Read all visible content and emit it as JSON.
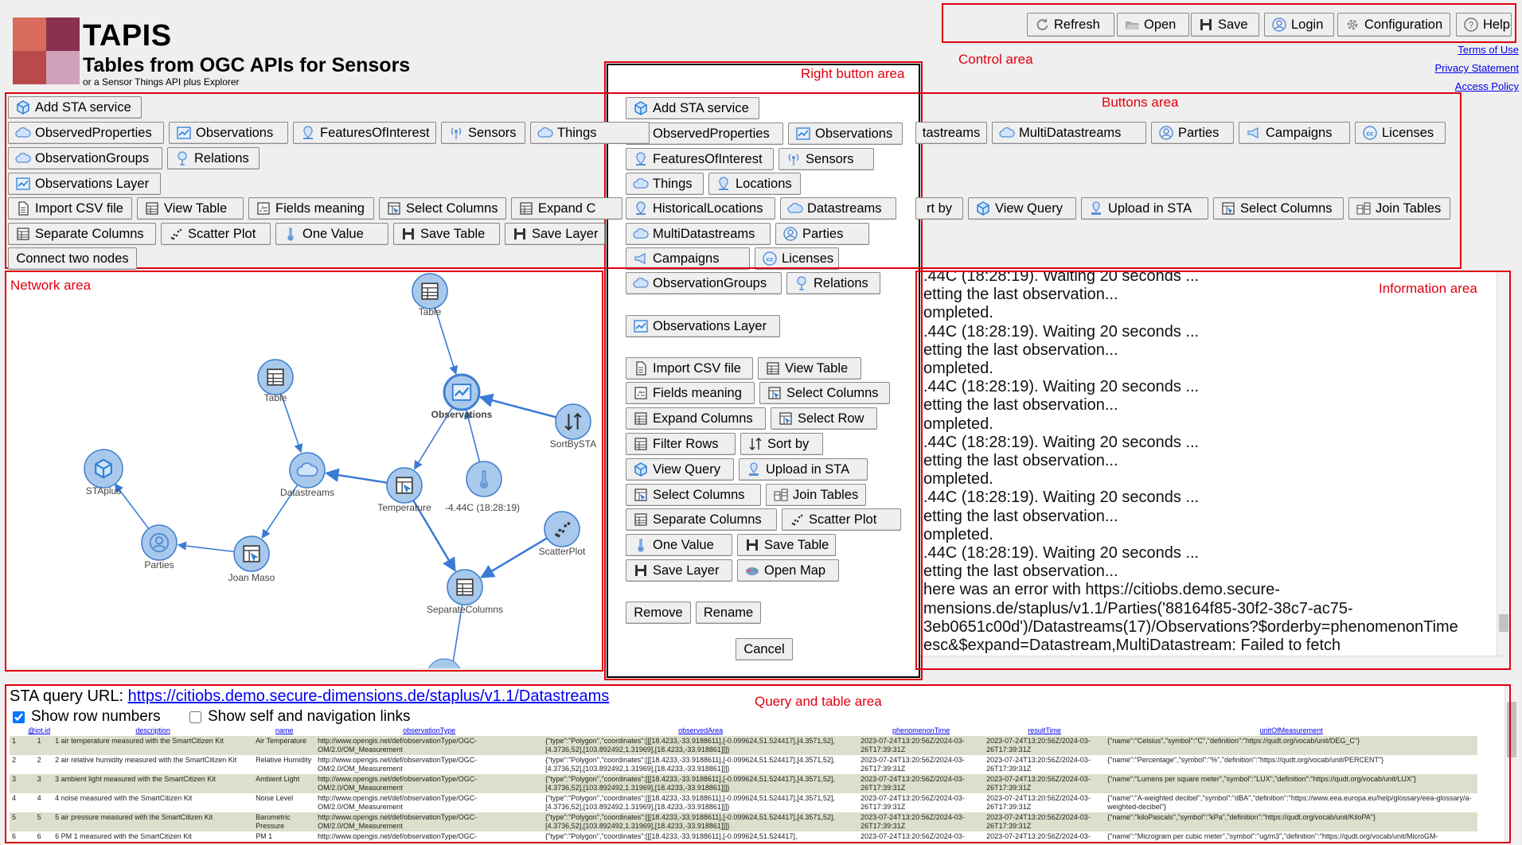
{
  "app": {
    "title": "TAPIS",
    "subtitle": "Tables from OGC APIs for Sensors",
    "tagline": "or a Sensor Things API plus Explorer"
  },
  "control_buttons": [
    {
      "label": "Refresh",
      "icon": "refresh-icon"
    },
    {
      "label": "Open",
      "icon": "folder-open-icon"
    },
    {
      "label": "Save",
      "icon": "floppy-disk-icon"
    },
    {
      "label": "Login",
      "icon": "user-icon"
    },
    {
      "label": "Configuration",
      "icon": "gear-icon"
    },
    {
      "label": "Help",
      "icon": "help-icon"
    }
  ],
  "links": [
    "Terms of Use",
    "Privacy Statement",
    "Access Policy"
  ],
  "annotations": {
    "control_area": "Control area",
    "right_button_area": "Right button area",
    "buttons_area": "Buttons area",
    "network_area": "Network area",
    "information_area": "Information area",
    "query_area": "Query and table area"
  },
  "toolbar": {
    "row1": [
      {
        "label": "Add STA service",
        "icon": "cube-icon"
      }
    ],
    "row2_left": [
      {
        "label": "ObservedProperties",
        "icon": "cloud-icon"
      },
      {
        "label": "Observations",
        "icon": "chart-line-icon"
      },
      {
        "label": "FeaturesOfInterest",
        "icon": "pin-icon"
      },
      {
        "label": "Sensors",
        "icon": "antenna-icon"
      },
      {
        "label": "Things",
        "icon": "cloud-icon"
      }
    ],
    "row2_right": [
      {
        "label": "tastreams",
        "icon": ""
      },
      {
        "label": "MultiDatastreams",
        "icon": "cloud-icon"
      },
      {
        "label": "Parties",
        "icon": "user-icon"
      },
      {
        "label": "Campaigns",
        "icon": "megaphone-icon"
      },
      {
        "label": "Licenses",
        "icon": "cc-icon"
      }
    ],
    "row3": [
      {
        "label": "ObservationGroups",
        "icon": "cloud-icon"
      },
      {
        "label": "Relations",
        "icon": "tree-icon"
      }
    ],
    "row4": [
      {
        "label": "Observations Layer",
        "icon": "chart-line-icon"
      }
    ],
    "row5_left": [
      {
        "label": "Import CSV file",
        "icon": "file-icon"
      },
      {
        "label": "View Table",
        "icon": "table-icon"
      },
      {
        "label": "Fields meaning",
        "icon": "fields-icon"
      },
      {
        "label": "Select Columns",
        "icon": "select-columns-icon"
      },
      {
        "label": "Expand C",
        "icon": "table-icon"
      }
    ],
    "row5_right": [
      {
        "label": "rt by",
        "icon": ""
      },
      {
        "label": "View Query",
        "icon": "cube-icon"
      },
      {
        "label": "Upload in STA",
        "icon": "upload-icon"
      },
      {
        "label": "Select Columns",
        "icon": "select-columns-icon"
      },
      {
        "label": "Join Tables",
        "icon": "join-icon"
      }
    ],
    "row6": [
      {
        "label": "Separate Columns",
        "icon": "table-icon"
      },
      {
        "label": "Scatter Plot",
        "icon": "scatter-icon"
      },
      {
        "label": "One Value",
        "icon": "thermometer-icon"
      },
      {
        "label": "Save Table",
        "icon": "floppy-disk-icon"
      },
      {
        "label": "Save Layer",
        "icon": "floppy-disk-icon"
      }
    ],
    "row7": [
      {
        "label": "Connect two nodes",
        "icon": ""
      }
    ]
  },
  "dialog": {
    "rows": [
      [
        {
          "label": "Add STA service",
          "icon": "cube-icon"
        }
      ],
      [
        {
          "label": "ObservedProperties",
          "icon": "cloud-icon"
        },
        {
          "label": "Observations",
          "icon": "chart-line-icon"
        }
      ],
      [
        {
          "label": "FeaturesOfInterest",
          "icon": "pin-icon"
        },
        {
          "label": "Sensors",
          "icon": "antenna-icon"
        }
      ],
      [
        {
          "label": "Things",
          "icon": "cloud-icon"
        },
        {
          "label": "Locations",
          "icon": "pin-icon"
        }
      ],
      [
        {
          "label": "HistoricalLocations",
          "icon": "pin-icon"
        },
        {
          "label": "Datastreams",
          "icon": "cloud-icon"
        }
      ],
      [
        {
          "label": "MultiDatastreams",
          "icon": "cloud-icon"
        },
        {
          "label": "Parties",
          "icon": "user-icon"
        }
      ],
      [
        {
          "label": "Campaigns",
          "icon": "megaphone-icon"
        },
        {
          "label": "Licenses",
          "icon": "cc-icon"
        }
      ],
      [
        {
          "label": "ObservationGroups",
          "icon": "cloud-icon"
        },
        {
          "label": "Relations",
          "icon": "tree-icon"
        }
      ],
      [
        {
          "label": "Observations Layer",
          "icon": "chart-line-icon"
        }
      ],
      [
        {
          "label": "Import CSV file",
          "icon": "file-icon"
        },
        {
          "label": "View Table",
          "icon": "table-icon"
        }
      ],
      [
        {
          "label": "Fields meaning",
          "icon": "fields-icon"
        },
        {
          "label": "Select Columns",
          "icon": "select-columns-icon"
        }
      ],
      [
        {
          "label": "Expand Columns",
          "icon": "table-icon"
        },
        {
          "label": "Select Row",
          "icon": "select-columns-icon"
        }
      ],
      [
        {
          "label": "Filter Rows",
          "icon": "table-icon"
        },
        {
          "label": "Sort by",
          "icon": "sort-icon"
        }
      ],
      [
        {
          "label": "View Query",
          "icon": "cube-icon"
        },
        {
          "label": "Upload in STA",
          "icon": "upload-icon"
        }
      ],
      [
        {
          "label": "Select Columns",
          "icon": "select-columns-icon"
        },
        {
          "label": "Join Tables",
          "icon": "join-icon"
        }
      ],
      [
        {
          "label": "Separate Columns",
          "icon": "table-icon"
        },
        {
          "label": "Scatter Plot",
          "icon": "scatter-icon"
        }
      ],
      [
        {
          "label": "One Value",
          "icon": "thermometer-icon"
        },
        {
          "label": "Save Table",
          "icon": "floppy-disk-icon"
        }
      ],
      [
        {
          "label": "Save Layer",
          "icon": "floppy-disk-icon"
        },
        {
          "label": "Open Map",
          "icon": "map-icon"
        }
      ]
    ],
    "remove": "Remove",
    "rename": "Rename",
    "cancel": "Cancel"
  },
  "network": {
    "nodes": [
      {
        "label": "Table",
        "icon": "table-icon"
      },
      {
        "label": "Table",
        "icon": "table-icon"
      },
      {
        "label": "Observations",
        "icon": "chart-line-icon"
      },
      {
        "label": "SortBySTA",
        "icon": "sort-icon"
      },
      {
        "label": "STAplus",
        "icon": "cube-icon"
      },
      {
        "label": "Datastreams",
        "icon": "cloud-icon"
      },
      {
        "label": "Temperature",
        "icon": "select-columns-icon"
      },
      {
        "label": "-4.44C (18:28:19)",
        "icon": "thermometer-icon"
      },
      {
        "label": "ScatterPlot",
        "icon": "scatter-icon"
      },
      {
        "label": "Parties",
        "icon": "user-icon"
      },
      {
        "label": "Joan Maso",
        "icon": "select-columns-icon"
      },
      {
        "label": "SeparateColumns",
        "icon": "table-icon"
      }
    ]
  },
  "info_log": [
    ".44C (18:28:19). Waiting 20 seconds ...",
    "etting the last observation...",
    "ompleted.",
    ".44C (18:28:19). Waiting 20 seconds ...",
    "etting the last observation...",
    "ompleted.",
    ".44C (18:28:19). Waiting 20 seconds ...",
    "etting the last observation...",
    "ompleted.",
    ".44C (18:28:19). Waiting 20 seconds ...",
    "etting the last observation...",
    "ompleted.",
    ".44C (18:28:19). Waiting 20 seconds ...",
    "etting the last observation...",
    "ompleted.",
    ".44C (18:28:19). Waiting 20 seconds ...",
    "etting the last observation...",
    "here was an error with https://citiobs.demo.secure-",
    "mensions.de/staplus/v1.1/Parties('88164f85-30f2-38c7-ac75-",
    "3eb0651c00d')/Datastreams(17)/Observations?$orderby=phenomenonTime",
    "esc&$expand=Datastream,MultiDatastream: Failed to fetch"
  ],
  "query": {
    "label": "STA query URL: ",
    "url": "https://citiobs.demo.secure-dimensions.de/staplus/v1.1/Datastreams",
    "show_row_numbers": "Show row numbers",
    "show_links": "Show self and navigation links",
    "columns": [
      "@iot.id",
      "description",
      "name",
      "observationType",
      "observedArea",
      "phenomenonTime",
      "resultTime",
      "unitOfMeasurement"
    ],
    "rows": [
      [
        "1",
        "1 air temperature measured with the SmartCitizen Kit",
        "Air Temperature",
        "http://www.opengis.net/def/observationType/OGC-OM/2.0/OM_Measurement",
        "{\"type\":\"Polygon\",\"coordinates\":[[[18.4233,-33.9188611],[-0.099624,51.524417],[4.3571,52],[4.3736,52],[103.892492,1.31969],[18.4233,-33.918861]]]}",
        "2023-07-24T13:20:56Z/2024-03-26T17:39:31Z",
        "2023-07-24T13:20:56Z/2024-03-26T17:39:31Z",
        "{\"name\":\"Celsius\",\"symbol\":\"C\",\"definition\":\"https://qudt.org/vocab/unit/DEG_C\"}"
      ],
      [
        "2",
        "2 air relative humidity measured with the SmartCitizen Kit",
        "Relative Humidity",
        "http://www.opengis.net/def/observationType/OGC-OM/2.0/OM_Measurement",
        "{\"type\":\"Polygon\",\"coordinates\":[[[18.4233,-33.9188611],[-0.099624,51.524417],[4.3571,52],[4.3736,52],[103.892492,1.31969],[18.4233,-33.918861]]]}",
        "2023-07-24T13:20:56Z/2024-03-26T17:39:31Z",
        "2023-07-24T13:20:56Z/2024-03-26T17:39:31Z",
        "{\"name\":\"Percentage\",\"symbol\":\"%\",\"definition\":\"https://qudt.org/vocab/unit/PERCENT\"}"
      ],
      [
        "3",
        "3 ambient light measured with the SmartCitizen Kit",
        "Ambient Light",
        "http://www.opengis.net/def/observationType/OGC-OM/2.0/OM_Measurement",
        "{\"type\":\"Polygon\",\"coordinates\":[[[18.4233,-33.9188611],[-0.099624,51.524417],[4.3571,52],[4.3736,52],[103.892492,1.31969],[18.4233,-33.918861]]]}",
        "2023-07-24T13:20:56Z/2024-03-26T17:39:31Z",
        "2023-07-24T13:20:56Z/2024-03-26T17:39:31Z",
        "{\"name\":\"Lumens per square meter\",\"symbol\":\"LUX\",\"definition\":\"https://qudt.org/vocab/unit/LUX\"}"
      ],
      [
        "4",
        "4 noise measured with the SmartCitizen Kit",
        "Noise Level",
        "http://www.opengis.net/def/observationType/OGC-OM/2.0/OM_Measurement",
        "{\"type\":\"Polygon\",\"coordinates\":[[[18.4233,-33.9188611],[-0.099624,51.524417],[4.3571,52],[4.3736,52],[103.892492,1.31969],[18.4233,-33.918861]]]}",
        "2023-07-24T13:20:56Z/2024-03-26T17:39:31Z",
        "2023-07-24T13:20:56Z/2024-03-26T17:39:31Z",
        "{\"name\":\"A-weighted decibel\",\"symbol\":\"dBA\",\"definition\":\"https://www.eea.europa.eu/help/glossary/eea-glossary/a-weighted-decibel\"}"
      ],
      [
        "5",
        "5 air pressure measured with the SmartCitizen Kit",
        "Barometric Pressure",
        "http://www.opengis.net/def/observationType/OGC-OM/2.0/OM_Measurement",
        "{\"type\":\"Polygon\",\"coordinates\":[[[18.4233,-33.9188611],[-0.099624,51.524417],[4.3571,52],[4.3736,52],[103.892492,1.31969],[18.4233,-33.918861]]]}",
        "2023-07-24T13:20:56Z/2024-03-26T17:39:31Z",
        "2023-07-24T13:20:56Z/2024-03-26T17:39:31Z",
        "{\"name\":\"kiloPascals\",\"symbol\":\"kPa\",\"definition\":\"https://qudt.org/vocab/unit/KiloPA\"}"
      ],
      [
        "6",
        "6 PM 1 measured with the SmartCitizen Kit",
        "PM 1",
        "http://www.opengis.net/def/observationType/OGC-",
        "{\"type\":\"Polygon\",\"coordinates\":[[[18.4233,-33.9188611],[-0.099624,51.524417],",
        "2023-07-24T13:20:56Z/2024-03-",
        "2023-07-24T13:20:56Z/2024-03-",
        "{\"name\":\"Microgram per cubic meter\",\"symbol\":\"ug/m3\",\"definition\":\"https://qudt.org/vocab/unit/MicroGM-"
      ]
    ]
  },
  "colors": {
    "annotation": "#e00010",
    "node_fill": "#a9c9ec",
    "node_stroke": "#3f7fcf",
    "edge": "#3a7bd5",
    "link": "#0000ee",
    "table_stripe": "#dcdfcc"
  }
}
